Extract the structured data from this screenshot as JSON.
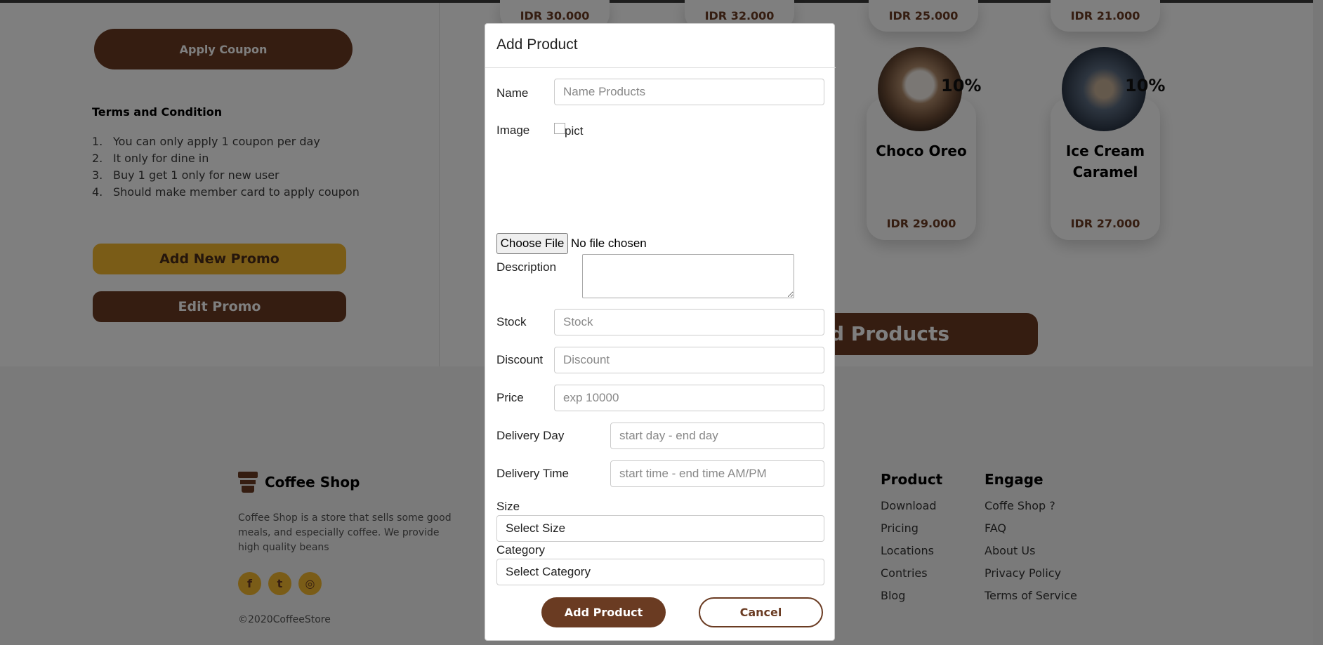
{
  "coupon": {
    "apply_label": "Apply Coupon",
    "terms_title": "Terms and Condition",
    "terms": [
      {
        "num": "1.",
        "text": "You can only apply 1 coupon per day"
      },
      {
        "num": "2.",
        "text": "It only for dine in"
      },
      {
        "num": "3.",
        "text": "Buy 1 get 1 only for new user"
      },
      {
        "num": "4.",
        "text": "Should make member card to apply coupon"
      }
    ],
    "add_promo_label": "Add New Promo",
    "edit_promo_label": "Edit Promo"
  },
  "products": {
    "top_row_prices": [
      "IDR 30.000",
      "IDR 32.000",
      "IDR 25.000",
      "IDR 21.000"
    ],
    "items": [
      {
        "name": "Choco Oreo",
        "price": "IDR 29.000",
        "discount": "10%"
      },
      {
        "name": "Ice Cream Caramel",
        "price": "IDR 27.000",
        "discount": "10%"
      }
    ],
    "all_products_label": "d Products"
  },
  "footer": {
    "brand": "Coffee Shop",
    "description": "Coffee Shop is a store that sells some good meals, and especially coffee. We provide high quality beans",
    "socials": [
      "facebook-icon",
      "twitter-icon",
      "instagram-icon"
    ],
    "copyright": "©2020CoffeeStore",
    "product_title": "Product",
    "product_links": [
      "Download",
      "Pricing",
      "Locations",
      "Contries",
      "Blog"
    ],
    "engage_title": "Engage",
    "engage_links": [
      "Coffe Shop ?",
      "FAQ",
      "About Us",
      "Privacy Policy",
      "Terms of Service"
    ]
  },
  "modal": {
    "title": "Add Product",
    "name_label": "Name",
    "name_placeholder": "Name Products",
    "image_label": "Image",
    "image_alt": "pict",
    "choose_file_label": "Choose File",
    "no_file_text": "No file chosen",
    "description_label": "Description",
    "stock_label": "Stock",
    "stock_placeholder": "Stock",
    "discount_label": "Discount",
    "discount_placeholder": "Discount",
    "price_label": "Price",
    "price_placeholder": "exp 10000",
    "delivery_day_label": "Delivery Day",
    "delivery_day_placeholder": "start day - end day",
    "delivery_time_label": "Delivery Time",
    "delivery_time_placeholder": "start time - end time AM/PM",
    "size_label": "Size",
    "size_value": "Select Size",
    "category_label": "Category",
    "category_value": "Select Category",
    "add_button": "Add Product",
    "cancel_button": "Cancel"
  },
  "colors": {
    "brown": "#6a3b22",
    "yellow": "#f5b92f"
  }
}
